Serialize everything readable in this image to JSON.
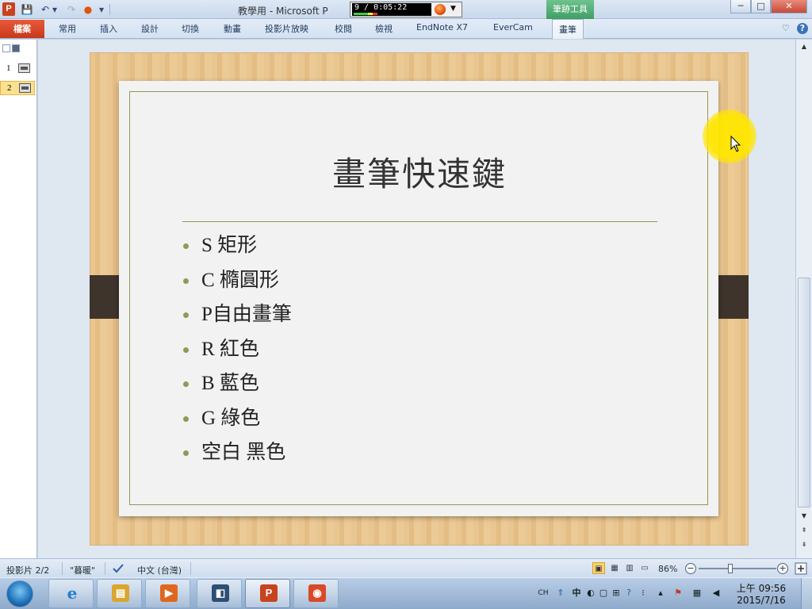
{
  "window": {
    "app_icon_letter": "P",
    "title": "教學用 - Microsoft P",
    "context_tab": "筆跡工具",
    "min_glyph": "─",
    "max_glyph": "□",
    "close_glyph": "✕"
  },
  "quick_access": {
    "save_icon": "💾",
    "undo_icon": "↶",
    "undo_drop": "▾",
    "redo_icon": "↷",
    "record_icon": "●",
    "customize_icon": "▾"
  },
  "recorder": {
    "timer": "9 / 0:05:22",
    "drop_glyph": "▼"
  },
  "ribbon": {
    "file_tab": "檔案",
    "tabs": [
      "常用",
      "插入",
      "設計",
      "切換",
      "動畫",
      "投影片放映",
      "校閱",
      "檢視",
      "EndNote X7",
      "EverCam"
    ],
    "active_tab": "畫筆",
    "minimize_glyph": "♡",
    "help_glyph": "?"
  },
  "slide_panel": {
    "slides": [
      {
        "number": "1"
      },
      {
        "number": "2"
      }
    ]
  },
  "slide": {
    "title": "畫筆快速鍵",
    "bullets": [
      "S 矩形",
      "C 橢圓形",
      "P自由畫筆",
      "R 紅色",
      "B 藍色",
      "G 綠色",
      "空白 黑色"
    ]
  },
  "scrollbar": {
    "up_glyph": "▲",
    "down_glyph": "▼",
    "prev_glyph": "⇞",
    "next_glyph": "⇟"
  },
  "status": {
    "slide_info": "投影片 2/2",
    "theme": "\"暮暖\"",
    "language": "中文 (台灣)",
    "zoom": "86%",
    "zoom_minus": "−",
    "zoom_plus": "+",
    "zoom_level_percent": 86
  },
  "taskbar": {
    "apps": [
      {
        "name": "internet-explorer",
        "glyph": "e",
        "color": "#1d7fd1"
      },
      {
        "name": "file-explorer",
        "glyph": "▤",
        "color": "#d9a62e"
      },
      {
        "name": "media-player",
        "glyph": "▶",
        "color": "#e0661f"
      },
      {
        "name": "recorder-app",
        "glyph": "◧",
        "color": "#2e4e74"
      },
      {
        "name": "powerpoint",
        "glyph": "P",
        "color": "#c8431f"
      },
      {
        "name": "evercam",
        "glyph": "◉",
        "color": "#d8492a"
      }
    ],
    "tray": {
      "ime": "CH",
      "ime_mode": "中",
      "time": "上午 09:56",
      "date": "2015/7/16"
    }
  },
  "colors": {
    "slide_accent": "#8f9a56",
    "file_tab": "#c53a1b",
    "context_tab": "#3f9f63",
    "highlight": "#ffe600"
  }
}
